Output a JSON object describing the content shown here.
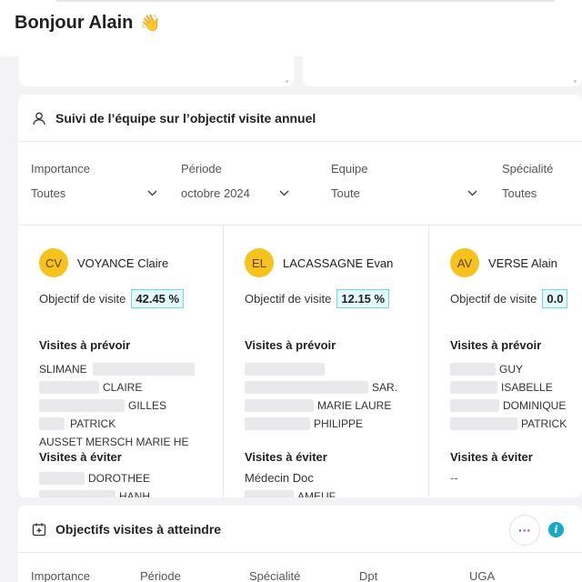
{
  "header": {
    "greeting": "Bonjour Alain",
    "wave": "👋"
  },
  "team_card": {
    "title": "Suivi de l’équipe sur l’objectif visite annuel",
    "filters": [
      {
        "label": "Importance",
        "value": "Toutes"
      },
      {
        "label": "Période",
        "value": "octobre 2024"
      },
      {
        "label": "Equipe",
        "value": "Toute"
      },
      {
        "label": "Spécialité",
        "value": "Toutes"
      }
    ],
    "objective_label": "Objectif de visite",
    "to_plan_label": "Visites à prévoir",
    "to_avoid_label": "Visites à éviter",
    "members": [
      {
        "initials": "CV",
        "name": "VOYANCE Claire",
        "percent": "42.45 %",
        "to_plan": [
          "SLIMANE",
          "CLAIRE",
          "GILLES",
          "PATRICK",
          "AUSSET MERSCH MARIE HE"
        ],
        "to_avoid": [
          "DOROTHEE",
          "HANH"
        ]
      },
      {
        "initials": "EL",
        "name": "LACASSAGNE Evan",
        "percent": "12.15 %",
        "to_plan": [
          "",
          "SAR.",
          "MARIE LAURE",
          "PHILIPPE"
        ],
        "to_avoid": [
          "Médecin Doc",
          "AMEUF"
        ]
      },
      {
        "initials": "AV",
        "name": "VERSE Alain",
        "percent": "0.0",
        "to_plan": [
          "GUY",
          "ISABELLE",
          "DOMINIQUE",
          "PATRICK"
        ],
        "to_avoid": [
          "--"
        ]
      }
    ]
  },
  "objectives_card": {
    "title": "Objectifs visites à atteindre",
    "more": "···",
    "info": "i",
    "filters": [
      "Importance",
      "Période",
      "Spécialité",
      "Dpt",
      "UGA"
    ]
  },
  "colors": {
    "avatar": "#f7c21c",
    "percent_border": "#6fd7e0",
    "percent_bg": "#e3fbfd",
    "info": "#17a9c9",
    "more": "#7b3fb6"
  },
  "icons": [
    "waving-hand-icon",
    "user-icon",
    "chevron-down-icon",
    "calendar-plus-icon",
    "more-icon",
    "info-icon"
  ]
}
